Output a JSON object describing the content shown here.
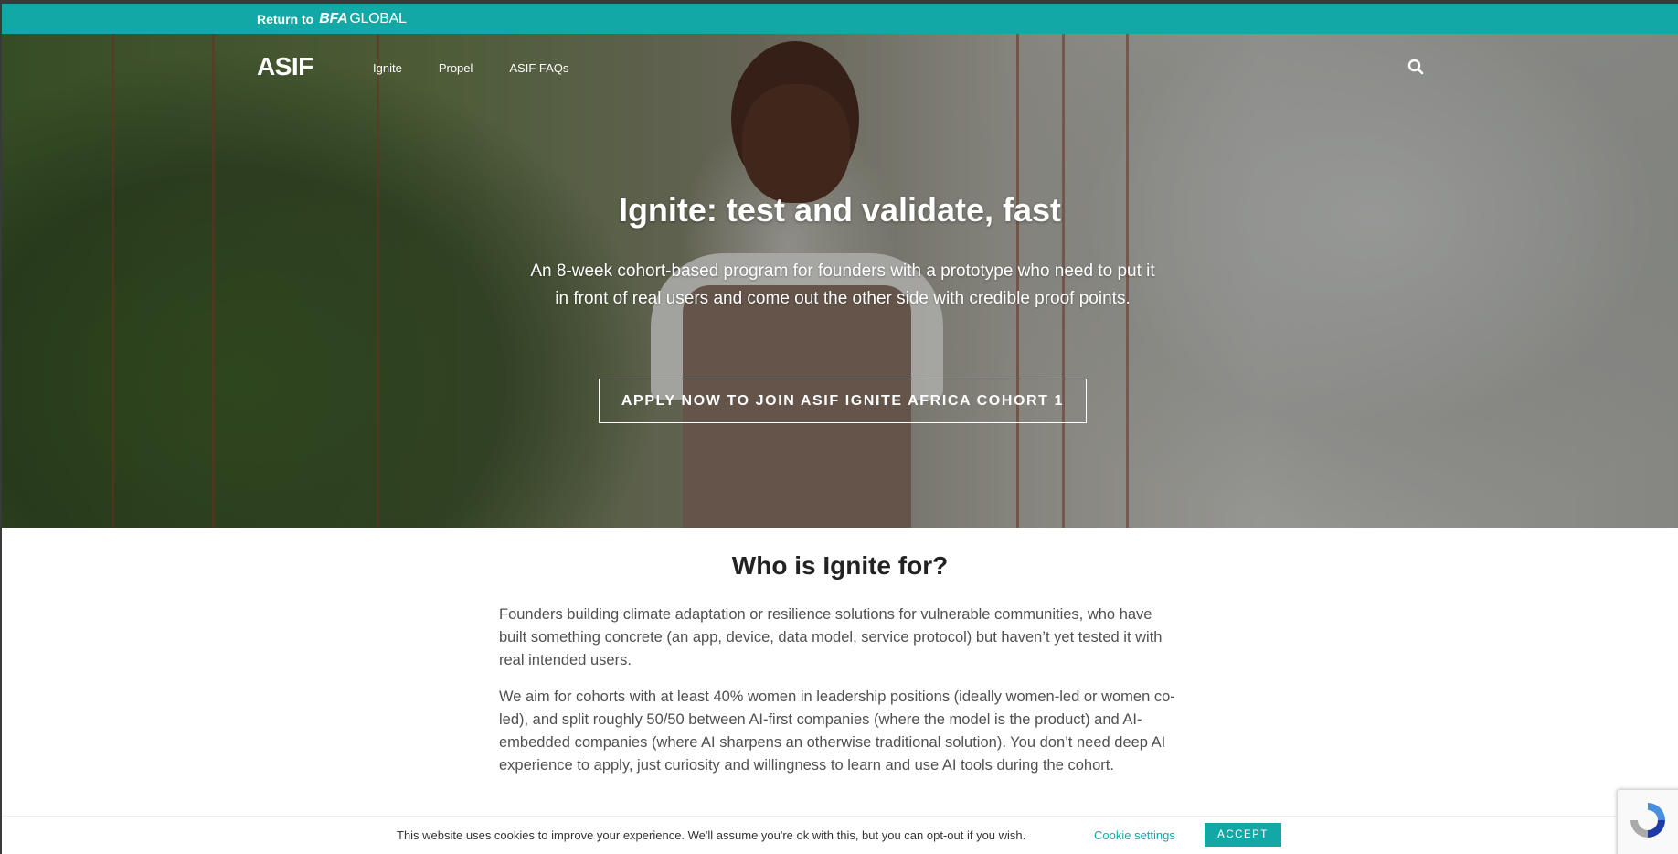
{
  "topbar": {
    "return_text": "Return to",
    "brand_bfa": "BFA",
    "brand_global": "GLOBAL"
  },
  "nav": {
    "logo": "ASIF",
    "items": [
      {
        "label": "Ignite"
      },
      {
        "label": "Propel"
      },
      {
        "label": "ASIF FAQs"
      }
    ],
    "search_icon": "search-icon"
  },
  "hero": {
    "title": "Ignite: test and validate, fast",
    "subtitle": "An 8-week cohort-based program for founders with a prototype who need to put it in front of real users and come out the other side with credible proof points.",
    "cta_label": "APPLY NOW TO JOIN ASIF IGNITE AFRICA COHORT 1"
  },
  "content": {
    "title": "Who is Ignite for?",
    "paragraph_1": "Founders building climate adaptation or resilience solutions for vulnerable communities, who have built something concrete (an app, device, data model, service protocol) but haven’t yet tested it with real intended users.",
    "paragraph_2": "We aim for cohorts with at least 40% women in leadership positions (ideally women-led or women co-led), and split roughly 50/50 between AI-first companies (where the model is the product) and AI-embedded companies (where AI sharpens an otherwise traditional solution). You don’t need deep AI experience to apply, just curiosity and willingness to learn and use AI tools during the cohort."
  },
  "cookie": {
    "message": "This website uses cookies to improve your experience. We'll assume you're ok with this, but you can opt-out if you wish.",
    "settings_label": "Cookie settings",
    "accept_label": "ACCEPT"
  },
  "colors": {
    "accent": "#12a8a6",
    "text_dark": "#222222",
    "text_body": "#505050"
  }
}
